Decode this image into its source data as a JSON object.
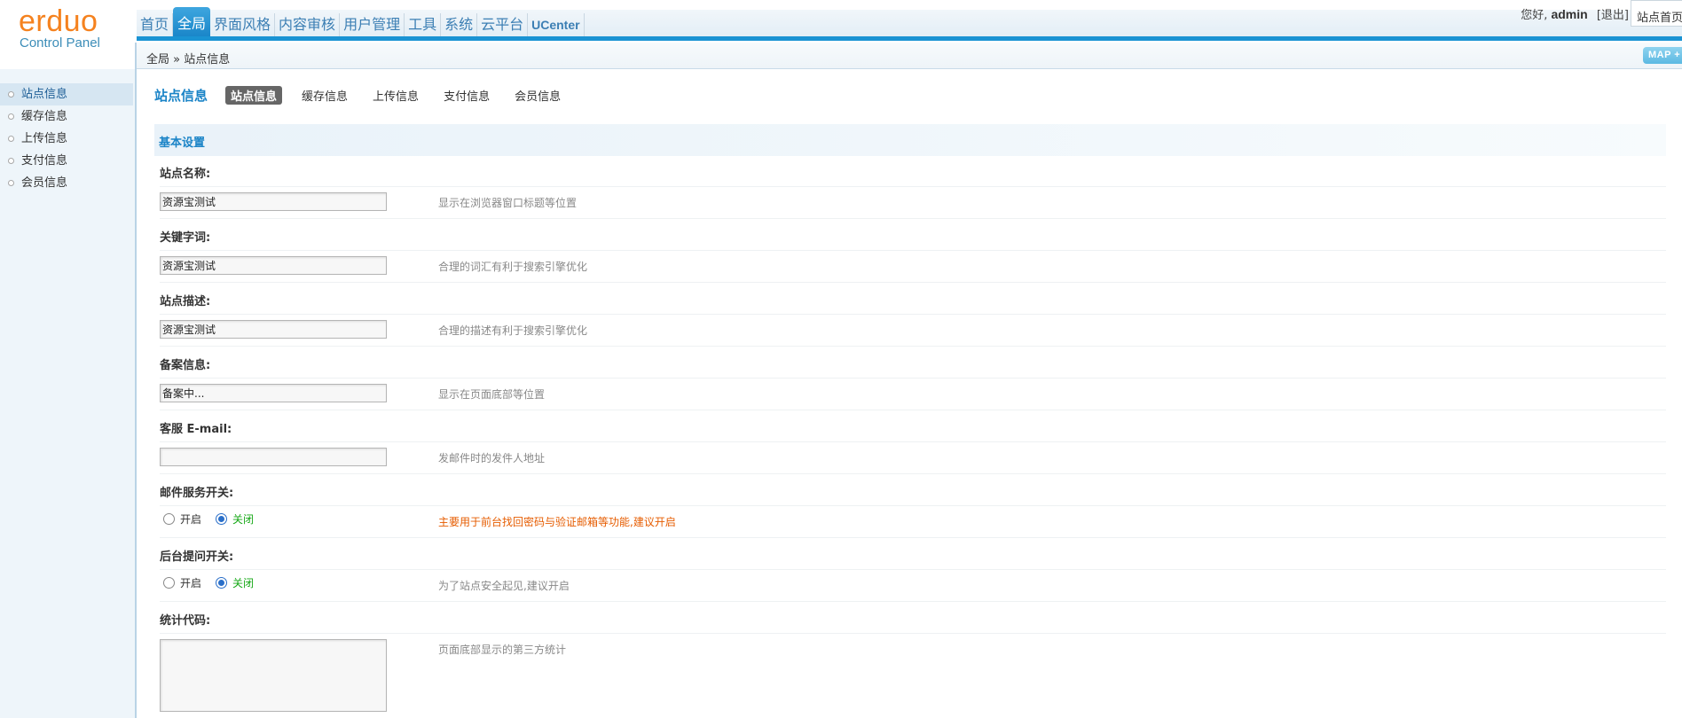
{
  "logo": {
    "main": "erduo",
    "sub": "Control Panel"
  },
  "nav": {
    "items": [
      {
        "label": "首页"
      },
      {
        "label": "全局"
      },
      {
        "label": "界面风格"
      },
      {
        "label": "内容审核"
      },
      {
        "label": "用户管理"
      },
      {
        "label": "工具"
      },
      {
        "label": "系统"
      },
      {
        "label": "云平台"
      },
      {
        "label": "UCenter"
      }
    ],
    "active": "全局"
  },
  "user": {
    "greeting": "您好,",
    "name": "admin",
    "logout": "[退出]",
    "site_home": "站点首页"
  },
  "breadcrumb": "全局 » 站点信息",
  "map_button": "MAP +",
  "sidebar": {
    "items": [
      {
        "label": "站点信息"
      },
      {
        "label": "缓存信息"
      },
      {
        "label": "上传信息"
      },
      {
        "label": "支付信息"
      },
      {
        "label": "会员信息"
      }
    ]
  },
  "page": {
    "title": "站点信息",
    "tabs": [
      {
        "label": "站点信息"
      },
      {
        "label": "缓存信息"
      },
      {
        "label": "上传信息"
      },
      {
        "label": "支付信息"
      },
      {
        "label": "会员信息"
      }
    ]
  },
  "section": {
    "title": "基本设置"
  },
  "fields": {
    "site_name": {
      "label": "站点名称:",
      "value": "资源宝测试",
      "hint": "显示在浏览器窗口标题等位置"
    },
    "keywords": {
      "label": "关键字词:",
      "value": "资源宝测试",
      "hint": "合理的词汇有利于搜索引擎优化"
    },
    "description": {
      "label": "站点描述:",
      "value": "资源宝测试",
      "hint": "合理的描述有利于搜索引擎优化"
    },
    "icp": {
      "label": "备案信息:",
      "value": "备案中...",
      "hint": "显示在页面底部等位置"
    },
    "email": {
      "label": "客服 E-mail:",
      "value": "",
      "hint": "发邮件时的发件人地址"
    },
    "mail_switch": {
      "label": "邮件服务开关:",
      "on": "开启",
      "off": "关闭",
      "selected": "关闭",
      "hint": "主要用于前台找回密码与验证邮箱等功能,建议开启"
    },
    "question_switch": {
      "label": "后台提问开关:",
      "on": "开启",
      "off": "关闭",
      "selected": "关闭",
      "hint": "为了站点安全起见,建议开启"
    },
    "stats_code": {
      "label": "统计代码:",
      "value": "",
      "hint": "页面底部显示的第三方统计"
    }
  }
}
